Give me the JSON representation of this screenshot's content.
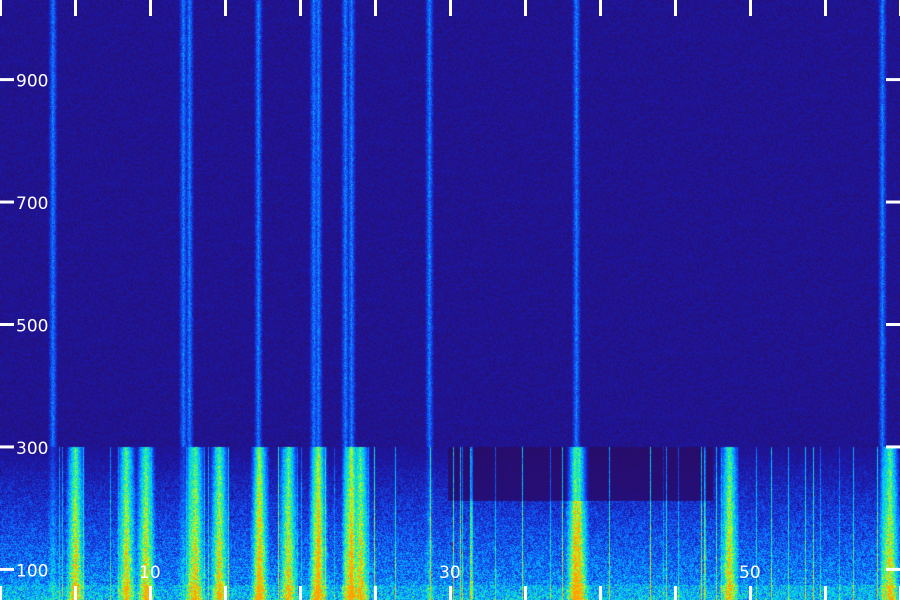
{
  "chart_data": {
    "type": "heatmap",
    "title": "",
    "xlabel": "",
    "ylabel": "",
    "x_ticks": [
      10,
      30,
      50
    ],
    "y_ticks": [
      100,
      300,
      500,
      700,
      900
    ],
    "xlim": [
      0,
      60
    ],
    "ylim": [
      50,
      1030
    ],
    "colormap": [
      "#2a0a5e",
      "#1a1ab0",
      "#1060ff",
      "#00c8ff",
      "#20f0a0",
      "#c0ff20",
      "#ffa000"
    ],
    "background_color": "#2a0a5e",
    "tick_color": "#ffffff",
    "grid": false,
    "strong_band_upper_limit": 300,
    "vertical_lines_x": [
      3.5,
      12.2,
      12.6,
      17.2,
      20.9,
      21.2,
      23.0,
      23.4,
      28.6,
      38.4,
      58.8
    ],
    "burst_columns_x": [
      5.0,
      8.4,
      9.7,
      13.0,
      14.6,
      17.3,
      19.2,
      21.2,
      23.4,
      24.0,
      38.3,
      38.6,
      48.6,
      59.3
    ]
  }
}
